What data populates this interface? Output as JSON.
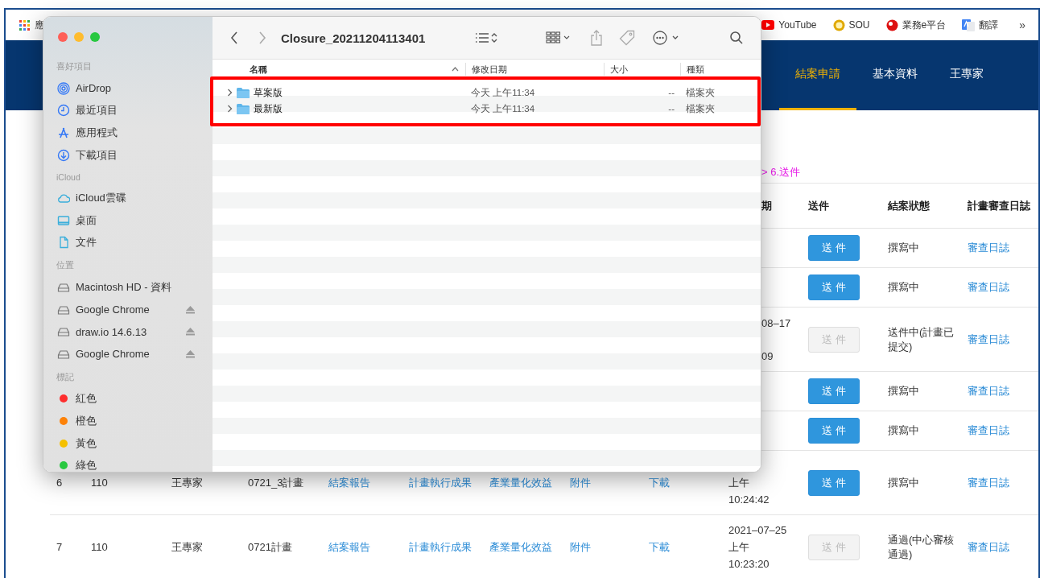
{
  "browser": {
    "bookmarks_left": [
      {
        "label": "應",
        "kind": "apps"
      }
    ],
    "bookmarks_right": [
      {
        "label": "YouTube",
        "kind": "youtube"
      },
      {
        "label": "SOU",
        "kind": "sou"
      },
      {
        "label": "業務e平台",
        "kind": "site"
      },
      {
        "label": "翻譯",
        "kind": "translate"
      }
    ],
    "overflow": "»"
  },
  "nav": {
    "items": [
      {
        "label": "結案申請",
        "selected": true
      },
      {
        "label": "基本資料",
        "selected": false
      },
      {
        "label": "王專家",
        "selected": false
      }
    ]
  },
  "breadcrumb": "> 6.送件",
  "table": {
    "columns": [
      "期",
      "送件",
      "結案狀態",
      "計畫審查日誌"
    ],
    "rows": [
      {
        "send": {
          "label": "送 件",
          "disabled": false
        },
        "status": "撰寫中",
        "log": "審查日誌"
      },
      {
        "send": {
          "label": "送 件",
          "disabled": false
        },
        "status": "撰寫中",
        "log": "審查日誌"
      },
      {
        "date": [
          "08–17",
          "09"
        ],
        "send": {
          "label": "送 件",
          "disabled": true
        },
        "status": "送件中(計畫已提交)",
        "log": "審查日誌"
      },
      {
        "send": {
          "label": "送 件",
          "disabled": false
        },
        "status": "撰寫中",
        "log": "審查日誌"
      },
      {
        "send": {
          "label": "送 件",
          "disabled": false
        },
        "status": "撰寫中",
        "log": "審查日誌"
      },
      {
        "index": "6",
        "year": "110",
        "expert": "王專家",
        "plan": "0721_3計畫",
        "links": [
          "結案報告",
          "計畫執行成果",
          "產業量化效益",
          "附件",
          "下載"
        ],
        "date": [
          "上午",
          "10:24:42"
        ],
        "send": {
          "label": "送 件",
          "disabled": false
        },
        "status": "撰寫中",
        "log": "審查日誌"
      },
      {
        "index": "7",
        "year": "110",
        "expert": "王專家",
        "plan": "0721計畫",
        "links": [
          "結案報告",
          "計畫執行成果",
          "產業量化效益",
          "附件",
          "下載"
        ],
        "date": [
          "2021–07–25",
          "上午",
          "10:23:20"
        ],
        "send": {
          "label": "送 件",
          "disabled": true
        },
        "status": "通過(中心審核通過)",
        "log": "審查日誌"
      }
    ]
  },
  "finder": {
    "title": "Closure_20211204113401",
    "sidebar": [
      {
        "heading": "喜好項目",
        "items": [
          {
            "label": "AirDrop",
            "kind": "airdrop"
          },
          {
            "label": "最近項目",
            "kind": "recent"
          },
          {
            "label": "應用程式",
            "kind": "apps"
          },
          {
            "label": "下載項目",
            "kind": "downloads"
          }
        ]
      },
      {
        "heading": "iCloud",
        "items": [
          {
            "label": "iCloud雲碟",
            "kind": "cloud"
          },
          {
            "label": "桌面",
            "kind": "desktop"
          },
          {
            "label": "文件",
            "kind": "document"
          }
        ]
      },
      {
        "heading": "位置",
        "items": [
          {
            "label": "Macintosh HD - 資料",
            "kind": "disk"
          },
          {
            "label": "Google Chrome",
            "kind": "disk",
            "ejectable": true
          },
          {
            "label": "draw.io 14.6.13",
            "kind": "disk",
            "ejectable": true
          },
          {
            "label": "Google Chrome",
            "kind": "disk",
            "ejectable": true
          }
        ]
      },
      {
        "heading": "標記",
        "items": [
          {
            "label": "紅色",
            "kind": "tag",
            "color": "#fe2d2d"
          },
          {
            "label": "橙色",
            "kind": "tag",
            "color": "#fd8208"
          },
          {
            "label": "黃色",
            "kind": "tag",
            "color": "#f5c000"
          },
          {
            "label": "綠色",
            "kind": "tag",
            "color": "#28c840"
          }
        ]
      }
    ],
    "columns": [
      "名稱",
      "修改日期",
      "大小",
      "種類"
    ],
    "rows": [
      {
        "name": "草案版",
        "modified": "今天 上午11:34",
        "size": "--",
        "file_type": "檔案夾",
        "expanded": false
      },
      {
        "name": "最新版",
        "modified": "今天 上午11:34",
        "size": "--",
        "file_type": "檔案夾",
        "expanded": false
      }
    ]
  }
}
